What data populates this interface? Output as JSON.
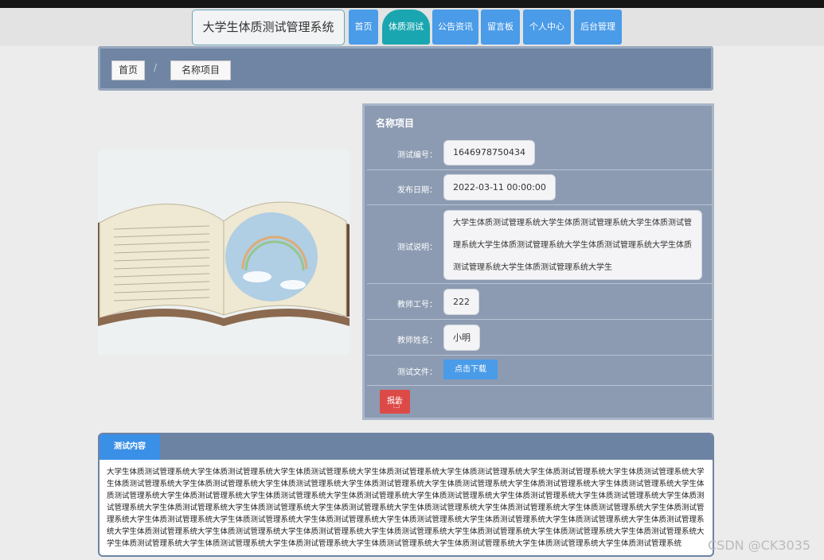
{
  "site": {
    "title": "大学生体质测试管理系统"
  },
  "nav": {
    "items": [
      {
        "label": "首页"
      },
      {
        "label": "体质测试",
        "active": true
      },
      {
        "label": "公告资讯"
      },
      {
        "label": "留言板"
      },
      {
        "label": "个人中心"
      },
      {
        "label": "后台管理"
      }
    ]
  },
  "breadcrumb": {
    "home": "首页",
    "current": "名称项目",
    "separator": "/"
  },
  "detail": {
    "title": "名称项目",
    "fields": {
      "id_label": "测试编号：",
      "id_value": "1646978750434",
      "date_label": "发布日期：",
      "date_value": "2022-03-11 00:00:00",
      "desc_label": "测试说明：",
      "desc_value": "大学生体质测试管理系统大学生体质测试管理系统大学生体质测试管理系统大学生体质测试管理系统大学生体质测试管理系统大学生体质测试管理系统大学生体质测试管理系统大学生",
      "teacher_no_label": "教师工号：",
      "teacher_no_value": "222",
      "teacher_name_label": "教师姓名：",
      "teacher_name_value": "小明",
      "file_label": "测试文件：",
      "download_label": "点击下载"
    },
    "report_label": "报告"
  },
  "content": {
    "tab_label": "测试内容",
    "text": "大学生体质测试管理系统大学生体质测试管理系统大学生体质测试管理系统大学生体质测试管理系统大学生体质测试管理系统大学生体质测试管理系统大学生体质测试管理系统大学生体质测试管理系统大学生体质测试管理系统大学生体质测试管理系统大学生体质测试管理系统大学生体质测试管理系统大学生体质测试管理系统大学生体质测试管理系统大学生体质测试管理系统大学生体质测试管理系统大学生体质测试管理系统大学生体质测试管理系统大学生体质测试管理系统大学生体质测试管理系统大学生体质测试管理系统大学生体质测试管理系统大学生体质测试管理系统大学生体质测试管理系统大学生体质测试管理系统大学生体质测试管理系统大学生体质测试管理系统大学生体质测试管理系统大学生体质测试管理系统大学生体质测试管理系统大学生体质测试管理系统大学生体质测试管理系统大学生体质测试管理系统大学生体质测试管理系统大学生体质测试管理系统大学生体质测试管理系统大学生体质测试管理系统大学生体质测试管理系统大学生体质测试管理系统大学生体质测试管理系统大学生体质测试管理系统大学生体质测试管理系统大学生体质测试管理系统大学生体质测试管理系统大学生体质测试管理系统大学生体质测试管理系统大学生体质测试管理系统大学生体质测试管理系统大学生体质测试管理系统大学生体质测试管理系统"
  },
  "watermark": "CSDN @CK3035",
  "colors": {
    "nav": "#4a9be8",
    "nav_active": "#1aa6b0",
    "panel": "#8c9bb2",
    "report": "#dc4a47"
  }
}
